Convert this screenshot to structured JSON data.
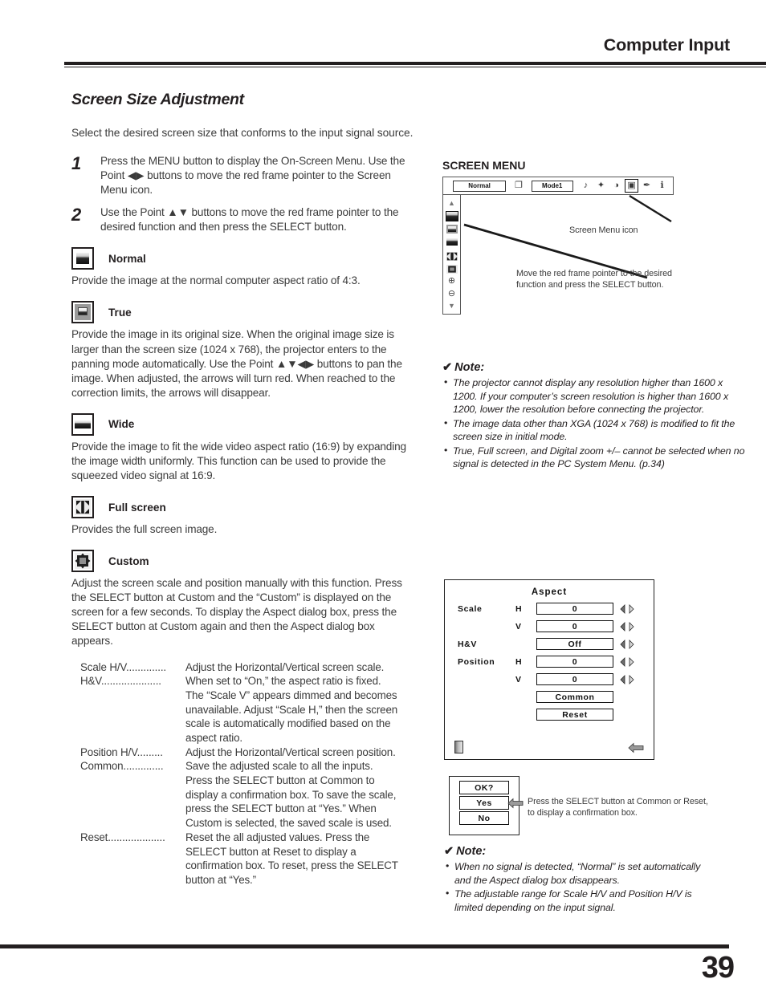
{
  "header": {
    "title": "Computer Input"
  },
  "section": {
    "title": "Screen Size Adjustment",
    "intro": "Select the desired screen size that conforms to the input signal source."
  },
  "steps": [
    {
      "number": "1",
      "text": "Press the MENU button to display the On-Screen Menu. Use the Point ◀▶ buttons to move the red frame pointer to the Screen Menu icon."
    },
    {
      "number": "2",
      "text": "Use the Point ▲▼ buttons to move the red frame pointer to the desired function and then press the SELECT button."
    }
  ],
  "functions": [
    {
      "icon": "normal-screen-icon",
      "label": "Normal",
      "body": "Provide the image at the normal computer aspect ratio of 4:3."
    },
    {
      "icon": "true-screen-icon",
      "label": "True",
      "body": "Provide the image in its original size. When the original image size is larger than the screen size (1024 x 768), the projector enters to the panning mode automatically. Use the Point ▲▼◀▶ buttons to pan the image. When adjusted, the arrows will turn red. When reached to the correction limits, the arrows will disappear."
    },
    {
      "icon": "wide-screen-icon",
      "label": "Wide",
      "body": "Provide the image to fit the wide video aspect ratio (16:9) by expanding the image width uniformly. This function can be used to provide the squeezed video signal at 16:9."
    },
    {
      "icon": "full-screen-icon",
      "label": "Full screen",
      "body": "Provides the full screen image."
    },
    {
      "icon": "custom-screen-icon",
      "label": "Custom",
      "body": "Adjust the screen scale and position manually with this function. Press the SELECT button at Custom and the “Custom” is displayed on the screen for a few seconds. To display the Aspect dialog box, press the SELECT button at Custom again and then the Aspect dialog box appears."
    }
  ],
  "definitions": [
    {
      "term": "Scale H/V",
      "dots": "..............",
      "lines": [
        "Adjust the Horizontal/Vertical screen scale."
      ]
    },
    {
      "term": "H&V",
      "dots": ".....................",
      "lines": [
        "When set to “On,” the aspect ratio is fixed.",
        "The “Scale V” appears dimmed and becomes",
        "unavailable. Adjust “Scale H,” then the screen",
        "scale is automatically modified based on the",
        "aspect ratio."
      ]
    },
    {
      "term": "Position H/V",
      "dots": ".........",
      "lines": [
        "Adjust the Horizontal/Vertical screen position."
      ]
    },
    {
      "term": "Common",
      "dots": "..............",
      "lines": [
        "Save the adjusted scale to all the inputs.",
        "Press the SELECT button at Common to",
        "display a confirmation box. To save the scale,",
        "press the SELECT button at “Yes.” When",
        "Custom is selected, the saved scale is used."
      ]
    },
    {
      "term": "Reset",
      "dots": "....................",
      "lines": [
        "Reset the all adjusted values. Press the",
        "SELECT button at Reset to display a",
        "confirmation box. To reset, press the SELECT",
        "button at “Yes.”"
      ]
    }
  ],
  "screen_menu": {
    "title": "SCREEN MENU",
    "bar": {
      "input_field": "Normal",
      "mode_field": "Mode1",
      "icons": [
        {
          "name": "input-source-icon",
          "glyph": "❐",
          "selected": false
        },
        {
          "name": "sound-icon",
          "glyph": "♪",
          "selected": false
        },
        {
          "name": "color-adjust-icon",
          "glyph": "✦",
          "selected": false
        },
        {
          "name": "image-select-icon",
          "glyph": "◑",
          "selected": false
        },
        {
          "name": "screen-menu-icon",
          "glyph": "▣",
          "selected": true
        },
        {
          "name": "setting-pencil-icon",
          "glyph": "✒",
          "selected": false
        },
        {
          "name": "information-icon",
          "glyph": "ℹ",
          "selected": false
        }
      ]
    },
    "side_items": [
      {
        "name": "scroll-up-arrow",
        "glyph": "▲",
        "highlight": false
      },
      {
        "name": "normal-screen-item",
        "glyph": "",
        "highlight": true
      },
      {
        "name": "true-screen-item",
        "glyph": "",
        "highlight": false
      },
      {
        "name": "wide-screen-item",
        "glyph": "",
        "highlight": false
      },
      {
        "name": "full-screen-item",
        "glyph": "",
        "highlight": false
      },
      {
        "name": "custom-screen-item",
        "glyph": "",
        "highlight": false
      },
      {
        "name": "digital-zoom-in-item",
        "glyph": "⊕",
        "highlight": false
      },
      {
        "name": "digital-zoom-out-item",
        "glyph": "⊖",
        "highlight": false
      },
      {
        "name": "scroll-down-arrow",
        "glyph": "▼",
        "highlight": false
      }
    ],
    "callout_icon": "Screen Menu icon",
    "callout_pointer": "Move the red frame pointer to the desired function and press the SELECT button."
  },
  "note1": {
    "heading": "Note:",
    "check": "✔",
    "items": [
      "The projector cannot display any resolution higher than 1600 x 1200. If your computer’s screen resolution is higher than 1600 x 1200, lower the resolution before connecting the projector.",
      "The image data other than XGA (1024 x 768) is modified to fit the screen size in initial mode.",
      "True, Full screen, and Digital zoom +/– cannot be selected when no signal is detected in the PC System Menu. (p.34)"
    ]
  },
  "aspect_dialog": {
    "title": "Aspect",
    "rows": [
      {
        "label": "Scale",
        "hv": "H",
        "value": "0",
        "arrows": true
      },
      {
        "label": "",
        "hv": "V",
        "value": "0",
        "arrows": true
      },
      {
        "label": "H&V",
        "hv": "",
        "value": "Off",
        "arrows": true
      },
      {
        "label": "Position",
        "hv": "H",
        "value": "0",
        "arrows": true
      },
      {
        "label": "",
        "hv": "V",
        "value": "0",
        "arrows": true
      },
      {
        "label": "",
        "hv": "",
        "value": "Common",
        "arrows": false
      },
      {
        "label": "",
        "hv": "",
        "value": "Reset",
        "arrows": false
      }
    ]
  },
  "ok_dialog": {
    "title": "OK?",
    "yes": "Yes",
    "no": "No",
    "caption": "Press the SELECT button at Common or Reset, to display a confirmation box."
  },
  "note2": {
    "heading": "Note:",
    "check": "✔",
    "items": [
      "When no signal is detected, “Normal” is set automatically and the Aspect dialog box disappears.",
      "The adjustable range for Scale H/V and Position H/V is limited depending on the input signal."
    ]
  },
  "footer": {
    "page_number": "39"
  }
}
